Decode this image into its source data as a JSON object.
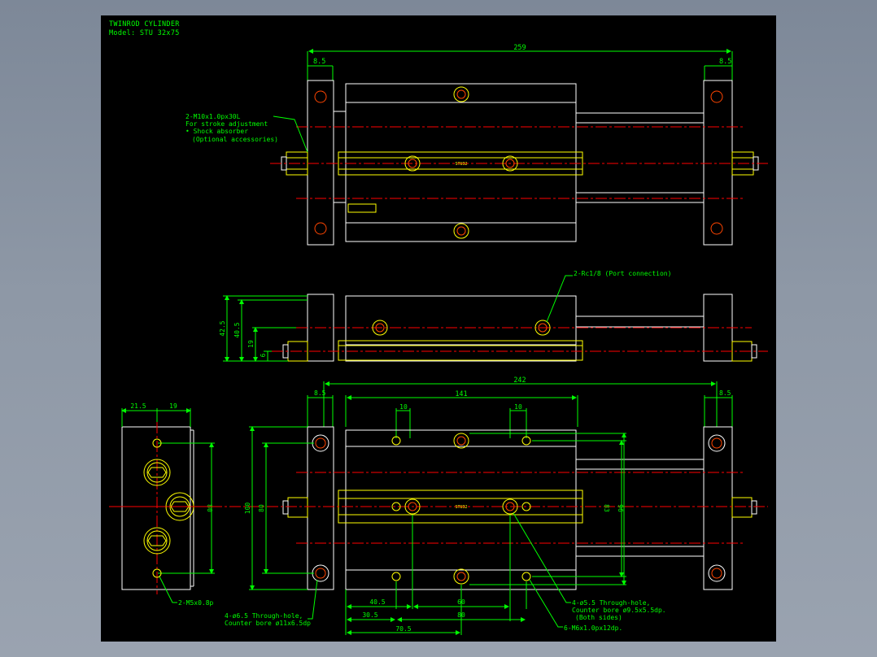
{
  "drawing": {
    "title_line1": "TWINROD CYLINDER",
    "title_line2": "Model: STU 32x75"
  },
  "colors": {
    "background": "#000000",
    "outline": "#ffffff",
    "hardware": "#ffff00",
    "dimension": "#00ff00",
    "centerline": "#ff0000",
    "hole": "#ff4500"
  },
  "top_view": {
    "dim_overall": "259",
    "dim_left_plate": "8.5",
    "dim_right_plate": "8.5",
    "note_l1": "2-M10x1.0px30L",
    "note_l2": "For stroke adjustment",
    "note_l3": "• Shock absorber",
    "note_l4": "(Optional accessories)",
    "label_body": "STU32"
  },
  "side_view": {
    "dim_42_5": "42.5",
    "dim_40_5": "40.5",
    "dim_19": "19",
    "dim_6": "6",
    "port_note": "2-Rc1/8 (Port connection)"
  },
  "front_view": {
    "dim_21_5": "21.5",
    "dim_19": "19",
    "dim_80": "80",
    "note": "2-M5x0.8p"
  },
  "bottom_view": {
    "dim_242": "242",
    "dim_141": "141",
    "dim_left_plate": "8.5",
    "dim_right_plate": "8.5",
    "dim_10a": "10",
    "dim_10b": "10",
    "dim_100": "100",
    "dim_80": "80",
    "dim_83": "83",
    "dim_96": "96",
    "dim_40_5": "40.5",
    "dim_60": "60",
    "dim_30_5": "30.5",
    "dim_80b": "80",
    "dim_70_5": "70.5",
    "label_body": "STU32",
    "note_a1": "4-ø6.5 Through-hole,",
    "note_a2": "Counter bore ø11x6.5dp",
    "note_b1": "4-ø5.5 Through-hole,",
    "note_b2": "Counter bore ø9.5x5.5dp.",
    "note_b3": "(Both sides)",
    "note_c": "6-M6x1.0px12dp."
  }
}
